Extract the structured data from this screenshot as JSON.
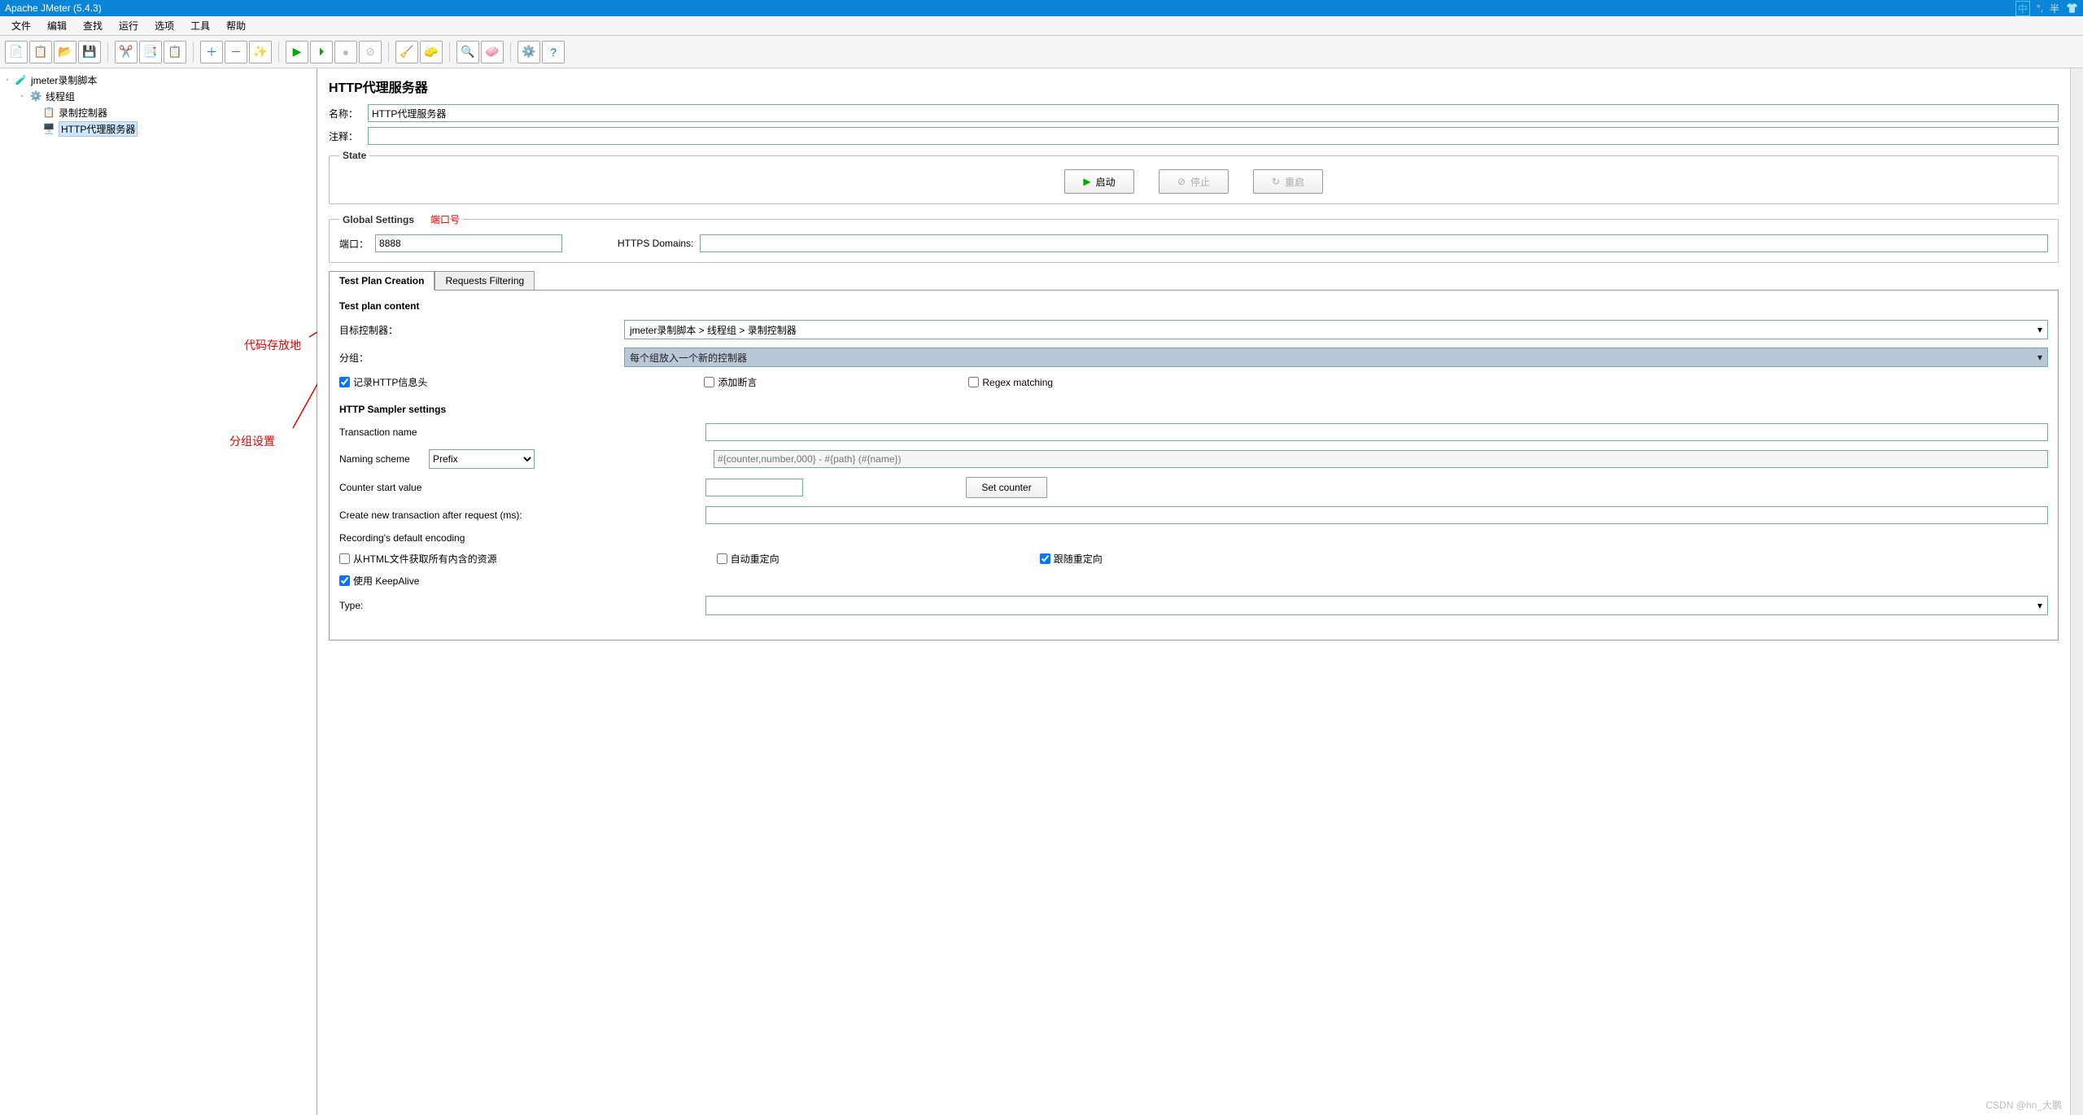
{
  "window": {
    "title": "Apache JMeter (5.4.3)"
  },
  "titlebar_right": {
    "ime": "中",
    "sep": "°,",
    "half": "半"
  },
  "menu": [
    "文件",
    "编辑",
    "查找",
    "运行",
    "选项",
    "工具",
    "帮助"
  ],
  "tree": {
    "root": "jmeter录制脚本",
    "group": "线程组",
    "controllers": [
      "录制控制器",
      "HTTP代理服务器"
    ]
  },
  "annotations": {
    "port": "端口号",
    "code_store": "代码存放地",
    "group": "分组设置"
  },
  "panel": {
    "title": "HTTP代理服务器",
    "name_label": "名称：",
    "name_value": "HTTP代理服务器",
    "comment_label": "注释：",
    "comment_value": ""
  },
  "state": {
    "legend": "State",
    "start": "启动",
    "stop": "停止",
    "restart": "重启"
  },
  "global": {
    "legend": "Global Settings",
    "port_label": "端口：",
    "port_value": "8888",
    "https_label": "HTTPS Domains:",
    "https_value": ""
  },
  "tabs": {
    "creation": "Test Plan Creation",
    "filtering": "Requests Filtering"
  },
  "content": {
    "legend": "Test plan content",
    "target_label": "目标控制器：",
    "target_value": "jmeter录制脚本 > 线程组 > 录制控制器",
    "group_label": "分组：",
    "group_value": "每个组放入一个新的控制器",
    "chk_http": "记录HTTP信息头",
    "chk_assert": "添加断言",
    "chk_regex": "Regex matching"
  },
  "sampler": {
    "legend": "HTTP Sampler settings",
    "txn_label": "Transaction name",
    "txn_value": "",
    "naming_label": "Naming scheme",
    "naming_value": "Prefix",
    "naming_placeholder": "#{counter,number,000} - #{path} (#{name})",
    "counter_label": "Counter start value",
    "counter_value": "",
    "set_counter": "Set counter",
    "create_txn_label": "Create new transaction after request (ms):",
    "create_txn_value": "",
    "encoding_label": "Recording's default encoding",
    "chk_html": "从HTML文件获取所有内含的资源",
    "chk_auto": "自动重定向",
    "chk_follow": "跟随重定向",
    "chk_keepalive": "使用 KeepAlive",
    "type_label": "Type:"
  },
  "watermark": "CSDN @hn_大鹏"
}
